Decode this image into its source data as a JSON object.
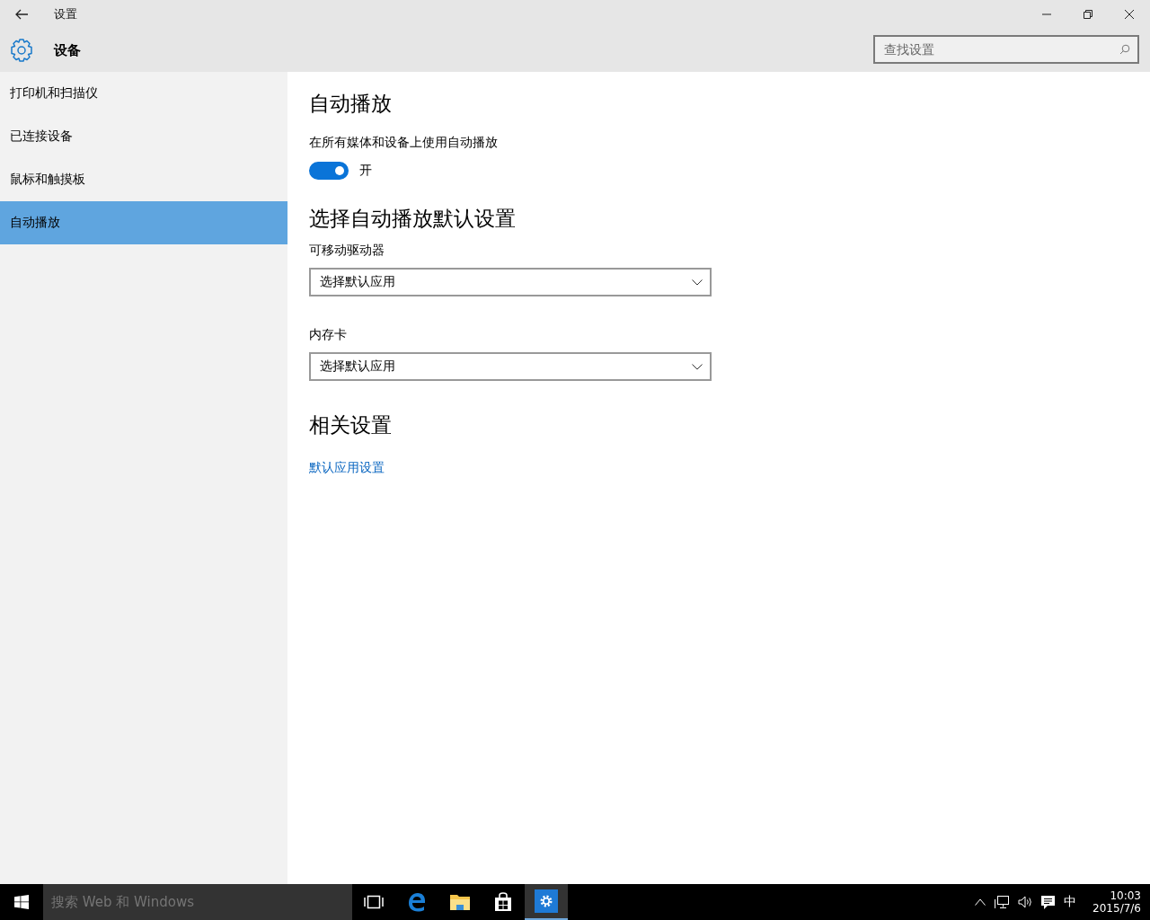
{
  "window": {
    "title": "设置",
    "section": "设备"
  },
  "search": {
    "placeholder": "查找设置"
  },
  "sidebar": {
    "items": [
      {
        "label": "打印机和扫描仪",
        "selected": false
      },
      {
        "label": "已连接设备",
        "selected": false
      },
      {
        "label": "鼠标和触摸板",
        "selected": false
      },
      {
        "label": "自动播放",
        "selected": true
      }
    ]
  },
  "content": {
    "title": "自动播放",
    "toggle": {
      "label": "在所有媒体和设备上使用自动播放",
      "on": true,
      "state_text": "开"
    },
    "defaults_title": "选择自动播放默认设置",
    "dropdowns": [
      {
        "label": "可移动驱动器",
        "value": "选择默认应用"
      },
      {
        "label": "内存卡",
        "value": "选择默认应用"
      }
    ],
    "related_title": "相关设置",
    "related_link": "默认应用设置"
  },
  "taskbar": {
    "search_placeholder": "搜索 Web 和 Windows",
    "apps": [
      {
        "kind": "taskview",
        "selected": false
      },
      {
        "kind": "edge",
        "selected": false
      },
      {
        "kind": "explorer",
        "selected": false
      },
      {
        "kind": "store",
        "selected": false
      },
      {
        "kind": "settings",
        "selected": true
      }
    ],
    "tray": {
      "ime": "中",
      "time": "10:03",
      "date": "2015/7/6"
    }
  }
}
